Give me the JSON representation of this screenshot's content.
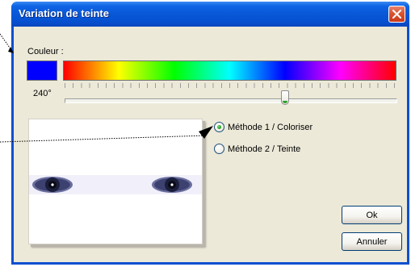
{
  "dialog": {
    "title": "Variation de teinte",
    "close_icon": "close-x-icon"
  },
  "hue": {
    "label": "Couleur :",
    "value_text": "240°",
    "value_degrees": 240,
    "max_degrees": 360,
    "swatch_color": "#0000ff"
  },
  "methods": {
    "option1": "Méthode 1 / Coloriser",
    "option2": "Méthode 2 / Teinte",
    "selected": 1
  },
  "buttons": {
    "ok": "Ok",
    "cancel": "Annuler"
  },
  "colors": {
    "title_bar": "#0858d8",
    "client_bg": "#ece9d8",
    "radio_selected": "#21a121",
    "close_button": "#d9532f"
  }
}
